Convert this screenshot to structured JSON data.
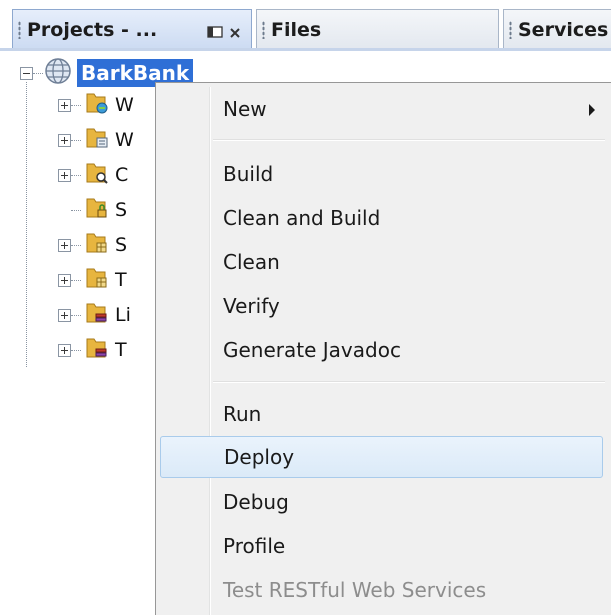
{
  "tabs": [
    {
      "label": "Projects - ...",
      "active": true
    },
    {
      "label": "Files",
      "active": false
    },
    {
      "label": "Services",
      "active": false
    }
  ],
  "project": {
    "name": "BarkBank",
    "nodes": [
      {
        "label": "W",
        "icon": "web-pages-folder-icon",
        "expandable": true
      },
      {
        "label": "W",
        "icon": "web-config-folder-icon",
        "expandable": true
      },
      {
        "label": "C",
        "icon": "config-files-folder-icon",
        "expandable": true
      },
      {
        "label": "S",
        "icon": "server-resources-folder-icon",
        "expandable": false
      },
      {
        "label": "S",
        "icon": "source-packages-folder-icon",
        "expandable": true
      },
      {
        "label": "T",
        "icon": "test-packages-folder-icon",
        "expandable": true
      },
      {
        "label": "Li",
        "icon": "libraries-folder-icon",
        "expandable": true
      },
      {
        "label": "T",
        "icon": "test-libraries-folder-icon",
        "expandable": true
      }
    ]
  },
  "context_menu": {
    "items": [
      {
        "label": "New",
        "has_submenu": true
      },
      {
        "label": "Build"
      },
      {
        "label": "Clean and Build"
      },
      {
        "label": "Clean"
      },
      {
        "label": "Verify"
      },
      {
        "label": "Generate Javadoc"
      },
      {
        "label": "Run"
      },
      {
        "label": "Deploy",
        "highlighted": true
      },
      {
        "label": "Debug"
      },
      {
        "label": "Profile"
      },
      {
        "label": "Test RESTful Web Services",
        "disabled": true
      }
    ]
  },
  "colors": {
    "selection": "#2f6fd6",
    "menu_background": "#f0f0f0",
    "menu_highlight_border": "#a9cbeb",
    "disabled_text": "#8d8d8d"
  }
}
